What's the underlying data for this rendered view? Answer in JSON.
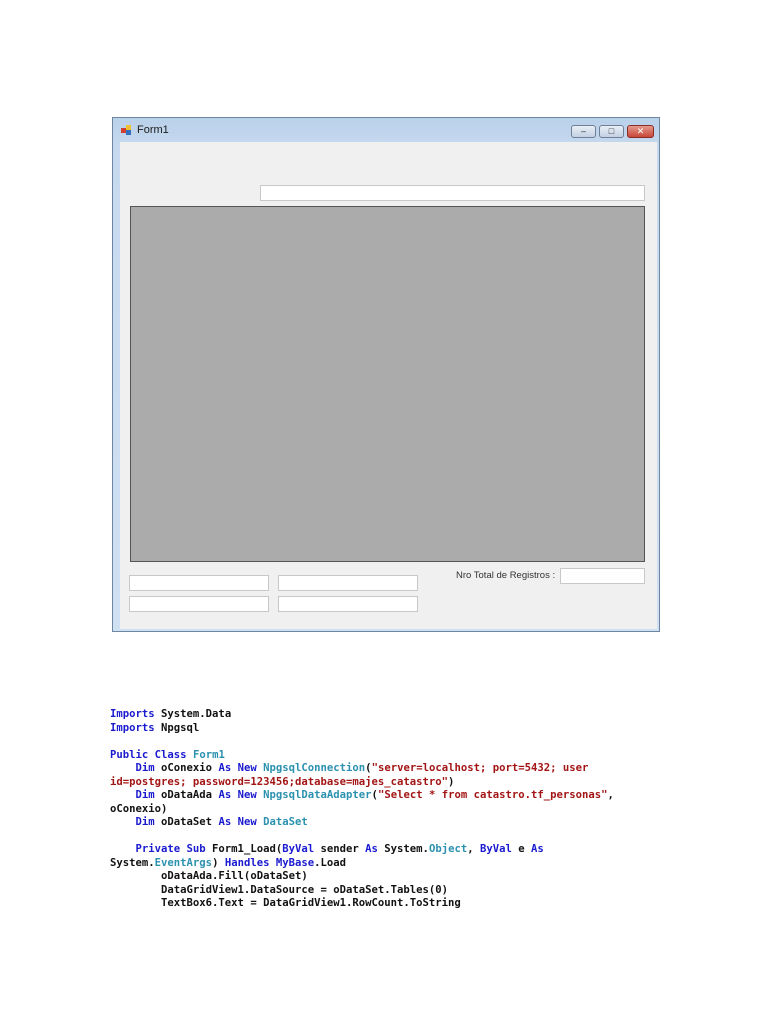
{
  "window": {
    "title": "Form1",
    "minimize": "–",
    "maximize": "□",
    "close": "✕",
    "close_color": "#c8463a"
  },
  "form": {
    "total_label": "Nro Total de Registros :"
  },
  "code": [
    [
      [
        "Imports",
        "kw"
      ],
      [
        " System.Data",
        ""
      ]
    ],
    [
      [
        "Imports",
        "kw"
      ],
      [
        " Npgsql",
        ""
      ]
    ],
    [],
    [
      [
        "Public Class",
        "kw"
      ],
      [
        " ",
        ""
      ],
      [
        "Form1",
        "ty"
      ]
    ],
    [
      [
        "    Dim",
        "kw"
      ],
      [
        " oConexio ",
        ""
      ],
      [
        "As New",
        "kw"
      ],
      [
        " ",
        ""
      ],
      [
        "NpgsqlConnection",
        "ty"
      ],
      [
        "(",
        ""
      ],
      [
        "\"server=localhost; port=5432; user",
        "st"
      ]
    ],
    [
      [
        "id=postgres; password=123456;database=majes_catastro\"",
        "st"
      ],
      [
        ")",
        ""
      ]
    ],
    [
      [
        "    Dim",
        "kw"
      ],
      [
        " oDataAda ",
        ""
      ],
      [
        "As New",
        "kw"
      ],
      [
        " ",
        ""
      ],
      [
        "NpgsqlDataAdapter",
        "ty"
      ],
      [
        "(",
        ""
      ],
      [
        "\"Select * from catastro.tf_personas\"",
        "st"
      ],
      [
        ",",
        ""
      ]
    ],
    [
      [
        "oConexio)",
        ""
      ]
    ],
    [
      [
        "    Dim",
        "kw"
      ],
      [
        " oDataSet ",
        ""
      ],
      [
        "As New",
        "kw"
      ],
      [
        " ",
        ""
      ],
      [
        "DataSet",
        "ty"
      ]
    ],
    [],
    [
      [
        "    Private Sub",
        "kw"
      ],
      [
        " Form1_Load(",
        ""
      ],
      [
        "ByVal",
        "kw"
      ],
      [
        " sender ",
        ""
      ],
      [
        "As",
        "kw"
      ],
      [
        " System.",
        ""
      ],
      [
        "Object",
        "ty"
      ],
      [
        ", ",
        ""
      ],
      [
        "ByVal",
        "kw"
      ],
      [
        " e ",
        ""
      ],
      [
        "As",
        "kw"
      ]
    ],
    [
      [
        "System.",
        ""
      ],
      [
        "EventArgs",
        "ty"
      ],
      [
        ") ",
        ""
      ],
      [
        "Handles",
        "kw"
      ],
      [
        " ",
        ""
      ],
      [
        "MyBase",
        "kw"
      ],
      [
        ".Load",
        ""
      ]
    ],
    [
      [
        "        oDataAda.Fill(oDataSet)",
        ""
      ]
    ],
    [
      [
        "        DataGridView1.DataSource = oDataSet.Tables(0)",
        ""
      ]
    ],
    [
      [
        "        TextBox6.Text = DataGridView1.RowCount.ToString",
        ""
      ]
    ]
  ]
}
